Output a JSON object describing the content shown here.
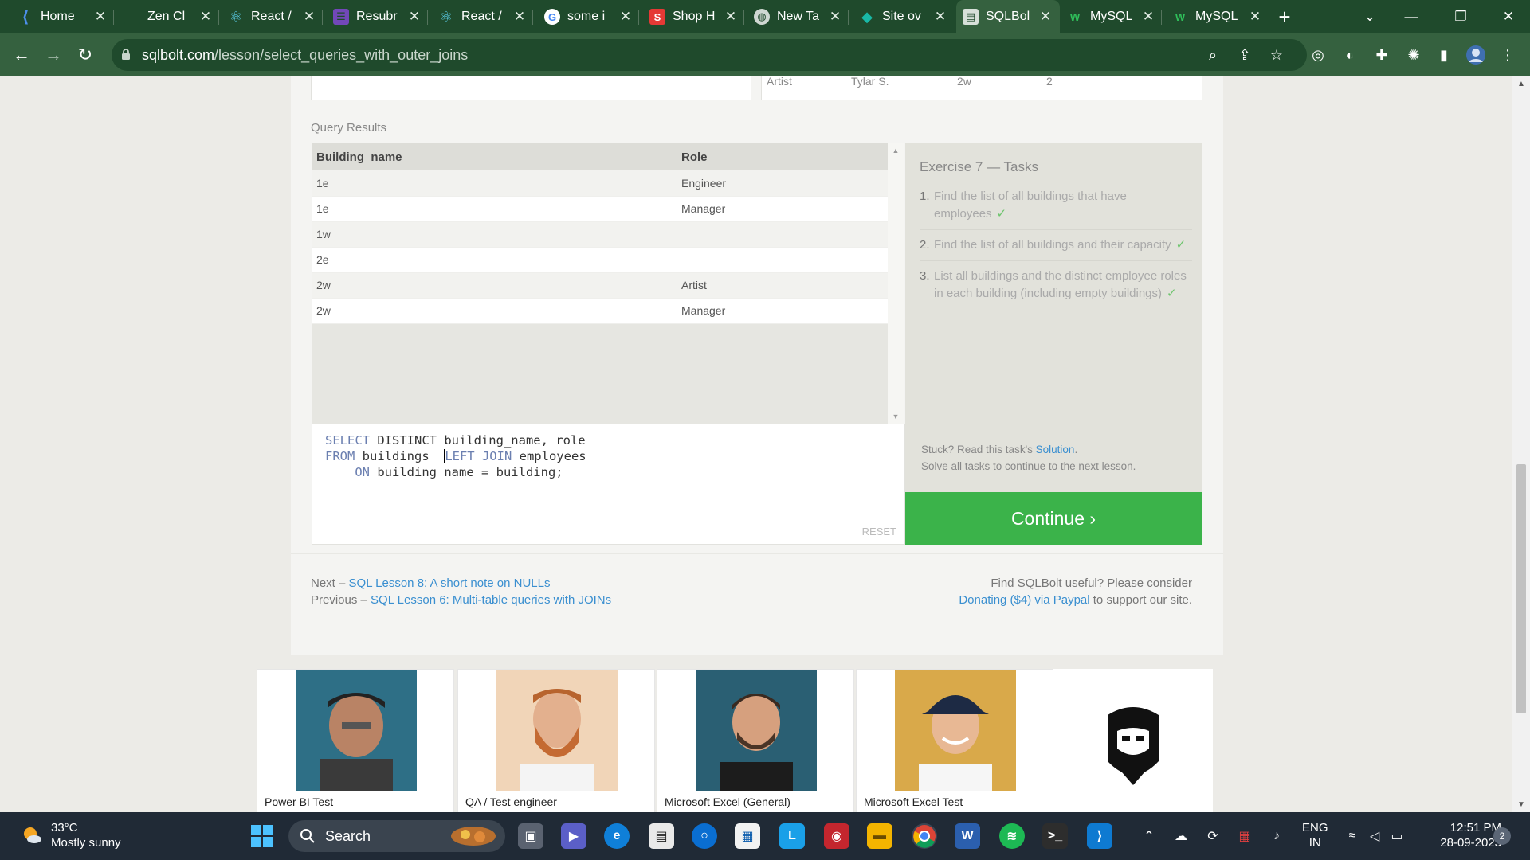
{
  "browser": {
    "tabs": [
      {
        "title": "Home",
        "icon": "home-tab-icon",
        "color": "#4d8fea"
      },
      {
        "title": "Zen Cl",
        "icon": "blank-tab-icon",
        "color": "#1f4a2c"
      },
      {
        "title": "React /",
        "icon": "react-icon",
        "color": "#61dafb"
      },
      {
        "title": "Resubr",
        "icon": "form-icon",
        "color": "#7248b9"
      },
      {
        "title": "React /",
        "icon": "react-icon",
        "color": "#61dafb"
      },
      {
        "title": "some i",
        "icon": "google-icon",
        "color": "#ffffff"
      },
      {
        "title": "Shop H",
        "icon": "s-logo-icon",
        "color": "#e53935"
      },
      {
        "title": "New Ta",
        "icon": "globe-icon",
        "color": "#cfd8d2"
      },
      {
        "title": "Site ov",
        "icon": "diamond-icon",
        "color": "#19b8a6"
      },
      {
        "title": "SQLBol",
        "icon": "sqlbolt-icon",
        "color": "#d7e0d9"
      },
      {
        "title": "MySQL",
        "icon": "w-logo-icon",
        "color": "#2fbf5a"
      },
      {
        "title": "MySQL",
        "icon": "w-logo-icon",
        "color": "#2fbf5a"
      }
    ],
    "url_domain": "sqlbolt.com",
    "url_path": "/lesson/select_queries_with_outer_joins"
  },
  "page": {
    "top_table_peek": [
      "Artist",
      "Tylar S.",
      "2w",
      "2"
    ],
    "query_results_label": "Query Results",
    "results": {
      "columns": [
        "Building_name",
        "Role"
      ],
      "rows": [
        [
          "1e",
          "Engineer"
        ],
        [
          "1e",
          "Manager"
        ],
        [
          "1w",
          ""
        ],
        [
          "2e",
          ""
        ],
        [
          "2w",
          "Artist"
        ],
        [
          "2w",
          "Manager"
        ]
      ]
    },
    "editor": {
      "line1_kw1": "SELECT",
      "line1_rest": " DISTINCT building_name, role",
      "line2_kw": "FROM",
      "line2_mid": " buildings  ",
      "line2_kw2": "LEFT JOIN",
      "line2_rest": " employees",
      "line3_kw": "ON",
      "line3_rest": " building_name = building;",
      "reset_label": "RESET"
    },
    "tasks": {
      "title": "Exercise 7 — Tasks",
      "items": [
        {
          "num": "1.",
          "text": "Find the list of all buildings that have employees",
          "check": "✓"
        },
        {
          "num": "2.",
          "text": "Find the list of all buildings and their capacity",
          "check": "✓"
        },
        {
          "num": "3.",
          "text": "List all buildings and the distinct employee roles in each building (including empty buildings)",
          "check": "✓"
        }
      ],
      "stuck_prefix": "Stuck? Read this task's ",
      "stuck_link": "Solution",
      "stuck_suffix": ".",
      "solve_note": "Solve all tasks to continue to the next lesson."
    },
    "continue_label": "Continue ›",
    "nav": {
      "next_prefix": "Next – ",
      "next_link": "SQL Lesson 8: A short note on NULLs",
      "prev_prefix": "Previous – ",
      "prev_link": "SQL Lesson 6: Multi-table queries with JOINs"
    },
    "support": {
      "line1": "Find SQLBolt useful? Please consider",
      "link": "Donating ($4) via Paypal",
      "suffix": " to support our site."
    },
    "ads": [
      {
        "caption": "Power BI Test",
        "bg": "#2e6f86"
      },
      {
        "caption": "QA / Test engineer",
        "bg": "#f1d5b8"
      },
      {
        "caption": "Microsoft Excel (General)",
        "bg": "#2a5f73"
      },
      {
        "caption": "Microsoft Excel Test",
        "bg": "#d9a94a"
      }
    ]
  },
  "taskbar": {
    "temperature": "33°C",
    "weather": "Mostly sunny",
    "search_label": "Search",
    "lang_line1": "ENG",
    "lang_line2": "IN",
    "time": "12:51 PM",
    "date": "28-09-2023",
    "notifications": "2"
  },
  "colors": {
    "browser_frame": "#1f4a2c",
    "continue_green": "#3bb34a",
    "link_blue": "#3a8fd0",
    "check_green": "#6cc46c"
  }
}
